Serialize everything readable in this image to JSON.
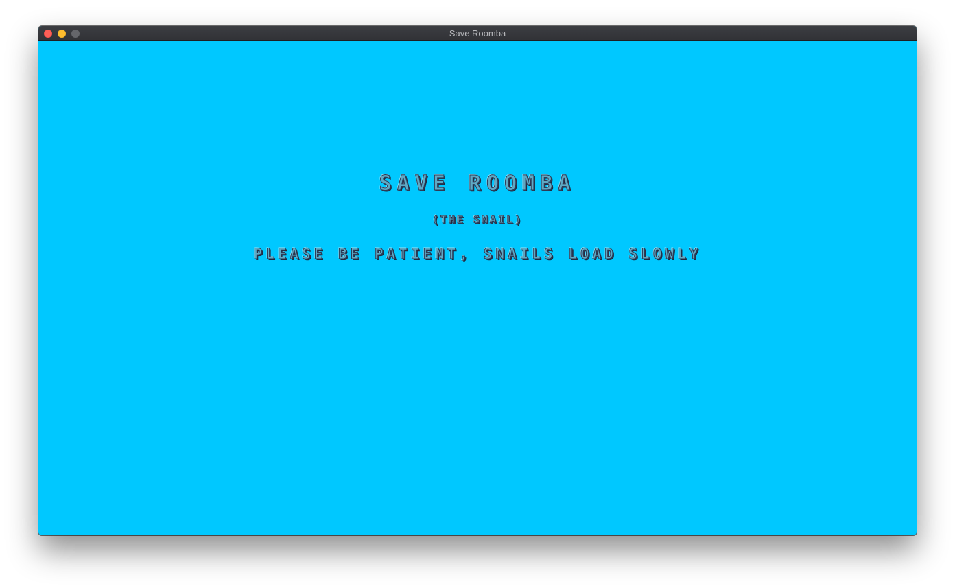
{
  "window": {
    "title": "Save Roomba"
  },
  "game": {
    "title": "Save Roomba",
    "subtitle": "(the snail)",
    "loading_message": "Please be patient, snails load slowly"
  },
  "colors": {
    "background": "#00c8ff",
    "text_fill": "#5fa9c4",
    "text_outline": "#2e3a55",
    "titlebar": "#36373b"
  }
}
